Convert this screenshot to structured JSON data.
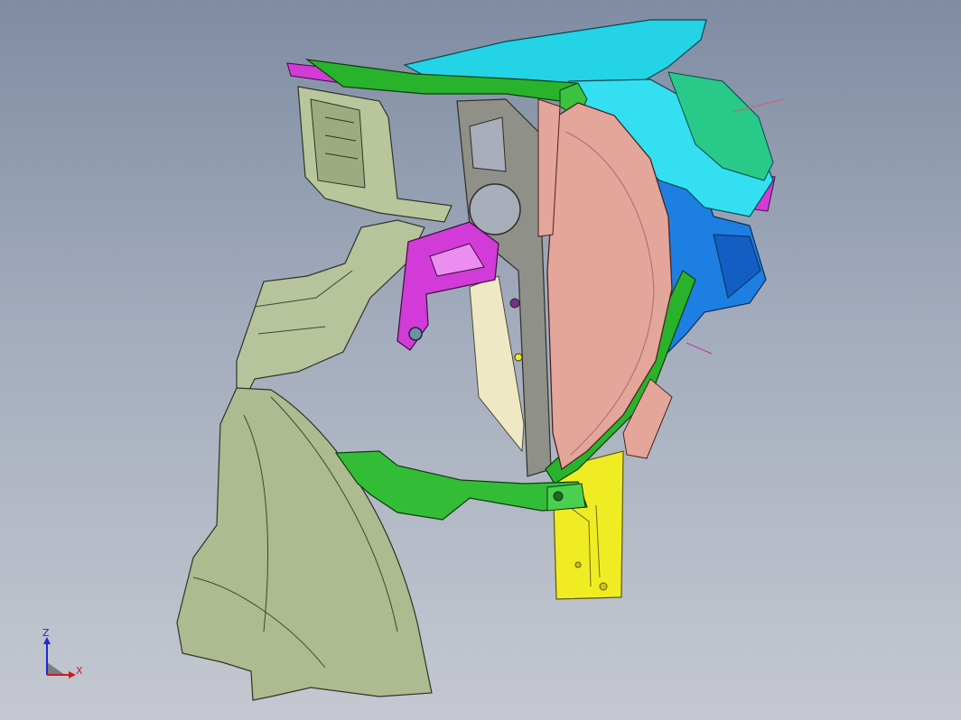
{
  "viewport": {
    "background_top": "#7f8ca2",
    "background_bottom": "#c5c8d0"
  },
  "model": {
    "parts": [
      {
        "name": "wheelhouse-liner",
        "color": "#b7c39b"
      },
      {
        "name": "mounting-bracket-green",
        "color": "#29b32c"
      },
      {
        "name": "headlamp-lens",
        "color": "#e4a59b"
      },
      {
        "name": "lamp-housing-cyan",
        "color": "#24d3e6"
      },
      {
        "name": "lamp-housing-blue",
        "color": "#1e7fe2"
      },
      {
        "name": "magenta-bracket",
        "color": "#d23bd8"
      },
      {
        "name": "grey-support-plate",
        "color": "#8f9088"
      },
      {
        "name": "cream-panel",
        "color": "#efe8c4"
      },
      {
        "name": "yellow-pillar",
        "color": "#f0ec23"
      }
    ]
  },
  "axis_triad": {
    "z_label": "Z",
    "x_label": "X",
    "z_color": "#1a2bd0",
    "x_color": "#d21a1a"
  }
}
